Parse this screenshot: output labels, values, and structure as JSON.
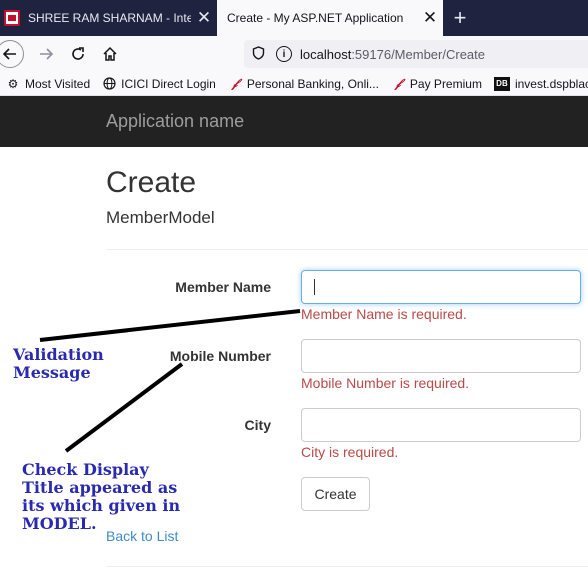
{
  "browser": {
    "tabs": [
      {
        "title": "SHREE RAM SHARNAM - Intern",
        "active": false
      },
      {
        "title": "Create - My ASP.NET Application",
        "active": true
      }
    ],
    "close_glyph": "✕",
    "new_tab_glyph": "+",
    "url_host": "localhost",
    "url_path": ":59176/Member/Create",
    "bookmarks": [
      {
        "label": "Most Visited",
        "icon": "gear-icon"
      },
      {
        "label": "ICICI Direct Login",
        "icon": "globe-icon"
      },
      {
        "label": "Personal Banking, Onli...",
        "icon": "red-script-icon"
      },
      {
        "label": "Pay Premium",
        "icon": "red-script-icon"
      },
      {
        "label": "invest.dspblackrock",
        "icon": "db-icon"
      }
    ]
  },
  "app": {
    "brand": "Application name"
  },
  "page": {
    "title": "Create",
    "subtitle": "MemberModel",
    "fields": [
      {
        "label": "Member Name",
        "value": "",
        "error": "Member Name is required."
      },
      {
        "label": "Mobile Number",
        "value": "",
        "error": "Mobile Number is required."
      },
      {
        "label": "City",
        "value": "",
        "error": "City is required."
      }
    ],
    "submit_label": "Create",
    "back_link": "Back to List"
  },
  "annotations": {
    "validation": [
      "Validation",
      "Message"
    ],
    "display_title": [
      "Check Display",
      "Title appeared as",
      "its which given in",
      "MODEL."
    ]
  },
  "colors": {
    "error": "#b94a48",
    "link": "#428bca",
    "annotation": "#2a2ab0",
    "appbar": "#222222"
  }
}
